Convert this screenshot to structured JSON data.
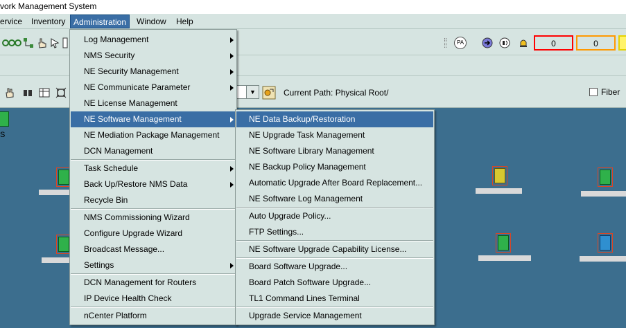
{
  "window": {
    "title": "vork Management System"
  },
  "menubar": {
    "items": [
      {
        "label": "ervice"
      },
      {
        "label": "Inventory"
      },
      {
        "label": "Administration"
      },
      {
        "label": "Window"
      },
      {
        "label": "Help"
      }
    ]
  },
  "toolbar": {
    "pa_label": "PA",
    "alarms": [
      {
        "value": "0",
        "color": "#ff0000"
      },
      {
        "value": "0",
        "color": "#ff9900"
      }
    ]
  },
  "pathbar": {
    "current_path": "Current Path: Physical Root/",
    "fiber_label": "Fiber"
  },
  "canvas": {
    "node_label": "S",
    "node_colors": {
      "green": "#2fb14a",
      "yellow": "#d8c830",
      "blue": "#2f8fd0"
    }
  },
  "admin_menu": {
    "items": [
      {
        "label": "Log Management",
        "submenu": true
      },
      {
        "label": "NMS Security",
        "submenu": true
      },
      {
        "label": "NE Security Management",
        "submenu": true
      },
      {
        "label": "NE Communicate Parameter",
        "submenu": true
      },
      {
        "label": "NE License Management",
        "submenu": false
      },
      {
        "label": "NE Software Management",
        "submenu": true,
        "highlighted": true
      },
      {
        "label": "NE Mediation Package Management",
        "submenu": false
      },
      {
        "label": "DCN Management",
        "submenu": false
      },
      {
        "label": "Task Schedule",
        "submenu": true
      },
      {
        "label": "Back Up/Restore NMS Data",
        "submenu": true
      },
      {
        "label": "Recycle Bin",
        "submenu": false
      },
      {
        "label": "NMS Commissioning Wizard",
        "submenu": false
      },
      {
        "label": "Configure Upgrade Wizard",
        "submenu": false
      },
      {
        "label": "Broadcast Message...",
        "submenu": false
      },
      {
        "label": "Settings",
        "submenu": true
      },
      {
        "label": "DCN Management for Routers",
        "submenu": false
      },
      {
        "label": "IP Device Health Check",
        "submenu": false
      },
      {
        "label": "nCenter Platform",
        "submenu": false
      }
    ]
  },
  "ne_software_submenu": {
    "items": [
      {
        "label": "NE Data Backup/Restoration",
        "highlighted": true
      },
      {
        "label": "NE Upgrade Task Management"
      },
      {
        "label": "NE Software Library Management"
      },
      {
        "label": "NE Backup Policy Management"
      },
      {
        "label": "Automatic Upgrade After Board Replacement..."
      },
      {
        "label": "NE Software Log Management"
      },
      {
        "label": "Auto Upgrade Policy..."
      },
      {
        "label": "FTP Settings..."
      },
      {
        "label": "NE Software Upgrade Capability License..."
      },
      {
        "label": "Board Software Upgrade..."
      },
      {
        "label": "Board Patch Software Upgrade..."
      },
      {
        "label": "TL1 Command Lines Terminal"
      },
      {
        "label": "Upgrade Service Management"
      }
    ]
  }
}
